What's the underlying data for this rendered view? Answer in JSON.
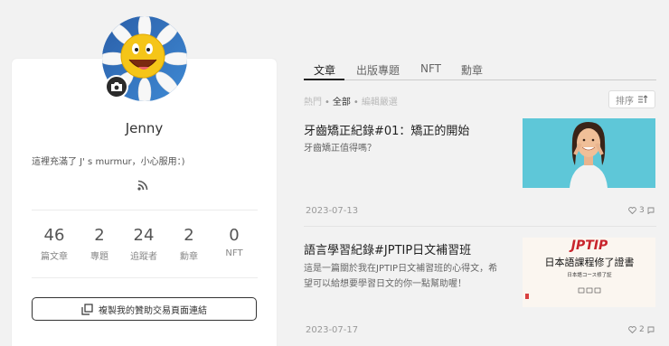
{
  "profile": {
    "name": "Jenny",
    "bio": "這裡充滿了 J' s murmur，小心服用：)",
    "stats": [
      {
        "value": "46",
        "label": "篇文章"
      },
      {
        "value": "2",
        "label": "專題"
      },
      {
        "value": "24",
        "label": "追蹤者"
      },
      {
        "value": "2",
        "label": "勳章"
      },
      {
        "value": "0",
        "label": "NFT"
      }
    ],
    "copy_button": "複製我的贊助交易頁面連結"
  },
  "tabs": [
    "文章",
    "出版專題",
    "NFT",
    "勳章"
  ],
  "filter": {
    "hot": "熱門",
    "all": "全部",
    "edit": "編輯嚴選"
  },
  "sort_label": "排序",
  "articles": [
    {
      "title": "牙齒矯正紀錄#01：矯正的開始",
      "excerpt": "牙齒矯正值得嗎？",
      "date": "2023-07-13",
      "likes": "3"
    },
    {
      "title": "語言學習紀錄#JPTIP日文補習班",
      "excerpt": "這是一篇關於我在JPTIP日文補習班的心得文，希望可以給想要學習日文的你一點幫助喔！",
      "date": "2023-07-17",
      "likes": "2",
      "image_text": {
        "logo": "JPTIP",
        "heading": "日本語課程修了證書",
        "sub": "日本語コース修了証"
      }
    }
  ],
  "colors": {
    "accent": "#222222",
    "image_bg": "#5ec7d8"
  },
  "icons": [
    "camera-icon",
    "rss-icon",
    "copy-icon",
    "sort-icon",
    "heart-icon",
    "comment-icon"
  ]
}
